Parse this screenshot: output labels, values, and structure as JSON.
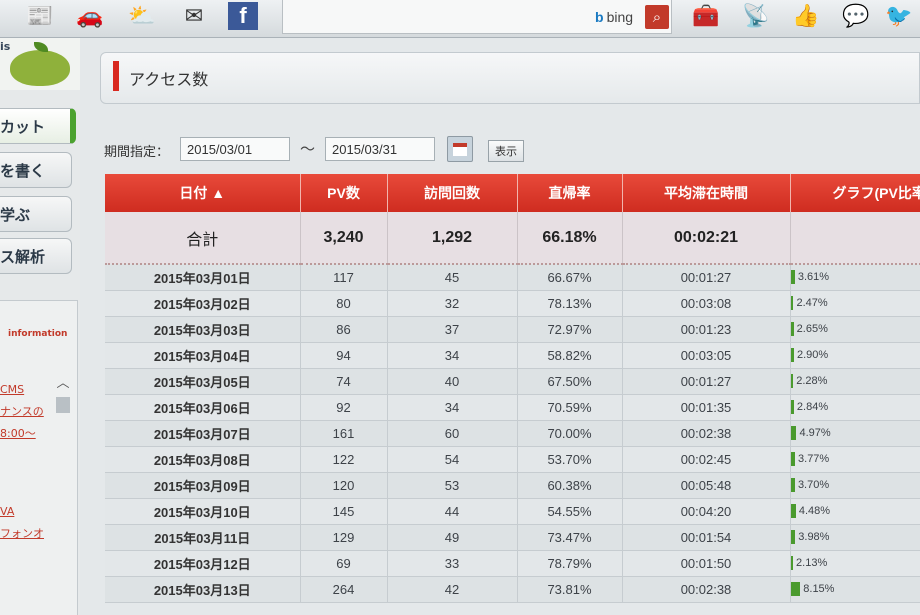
{
  "search": {
    "engine_label": "bing"
  },
  "sidebar": {
    "logo_text": "is",
    "nav": [
      "カット",
      "を書く",
      "学ぶ",
      "ス解析"
    ],
    "info_label": "information",
    "info_links": [
      "CMS",
      "ナンスの",
      "8:00〜",
      "VA",
      "フォンオ"
    ]
  },
  "main": {
    "title": "アクセス数",
    "period_label": "期間指定：",
    "start_date": "2015/03/01",
    "tilde": "〜",
    "end_date": "2015/03/31",
    "show_button": "表示"
  },
  "table": {
    "headers": [
      "日付 ▲",
      "PV数",
      "訪問回数",
      "直帰率",
      "平均滞在時間",
      "グラフ(PV比率"
    ],
    "total": {
      "label": "合計",
      "pv": "3,240",
      "visits": "1,292",
      "bounce": "66.18%",
      "avg_time": "00:02:21"
    },
    "rows": [
      {
        "date": "2015年03月01日",
        "pv": "117",
        "visits": "45",
        "bounce": "66.67%",
        "time": "00:01:27",
        "ratio": "3.61%",
        "ratio_value": 3.61
      },
      {
        "date": "2015年03月02日",
        "pv": "80",
        "visits": "32",
        "bounce": "78.13%",
        "time": "00:03:08",
        "ratio": "2.47%",
        "ratio_value": 2.47
      },
      {
        "date": "2015年03月03日",
        "pv": "86",
        "visits": "37",
        "bounce": "72.97%",
        "time": "00:01:23",
        "ratio": "2.65%",
        "ratio_value": 2.65
      },
      {
        "date": "2015年03月04日",
        "pv": "94",
        "visits": "34",
        "bounce": "58.82%",
        "time": "00:03:05",
        "ratio": "2.90%",
        "ratio_value": 2.9
      },
      {
        "date": "2015年03月05日",
        "pv": "74",
        "visits": "40",
        "bounce": "67.50%",
        "time": "00:01:27",
        "ratio": "2.28%",
        "ratio_value": 2.28
      },
      {
        "date": "2015年03月06日",
        "pv": "92",
        "visits": "34",
        "bounce": "70.59%",
        "time": "00:01:35",
        "ratio": "2.84%",
        "ratio_value": 2.84
      },
      {
        "date": "2015年03月07日",
        "pv": "161",
        "visits": "60",
        "bounce": "70.00%",
        "time": "00:02:38",
        "ratio": "4.97%",
        "ratio_value": 4.97
      },
      {
        "date": "2015年03月08日",
        "pv": "122",
        "visits": "54",
        "bounce": "53.70%",
        "time": "00:02:45",
        "ratio": "3.77%",
        "ratio_value": 3.77
      },
      {
        "date": "2015年03月09日",
        "pv": "120",
        "visits": "53",
        "bounce": "60.38%",
        "time": "00:05:48",
        "ratio": "3.70%",
        "ratio_value": 3.7
      },
      {
        "date": "2015年03月10日",
        "pv": "145",
        "visits": "44",
        "bounce": "54.55%",
        "time": "00:04:20",
        "ratio": "4.48%",
        "ratio_value": 4.48
      },
      {
        "date": "2015年03月11日",
        "pv": "129",
        "visits": "49",
        "bounce": "73.47%",
        "time": "00:01:54",
        "ratio": "3.98%",
        "ratio_value": 3.98
      },
      {
        "date": "2015年03月12日",
        "pv": "69",
        "visits": "33",
        "bounce": "78.79%",
        "time": "00:01:50",
        "ratio": "2.13%",
        "ratio_value": 2.13
      },
      {
        "date": "2015年03月13日",
        "pv": "264",
        "visits": "42",
        "bounce": "73.81%",
        "time": "00:02:38",
        "ratio": "8.15%",
        "ratio_value": 8.15
      }
    ]
  },
  "colors": {
    "header_red": "#d8281f",
    "bar_green": "#4a9a2e"
  },
  "icons": [
    "newspaper-icon",
    "car-icon",
    "weather-icon",
    "mail-icon",
    "facebook-icon",
    "search-icon",
    "tools-icon",
    "satellite-icon",
    "thumbs-up-icon",
    "chat-icon",
    "bird-icon"
  ]
}
